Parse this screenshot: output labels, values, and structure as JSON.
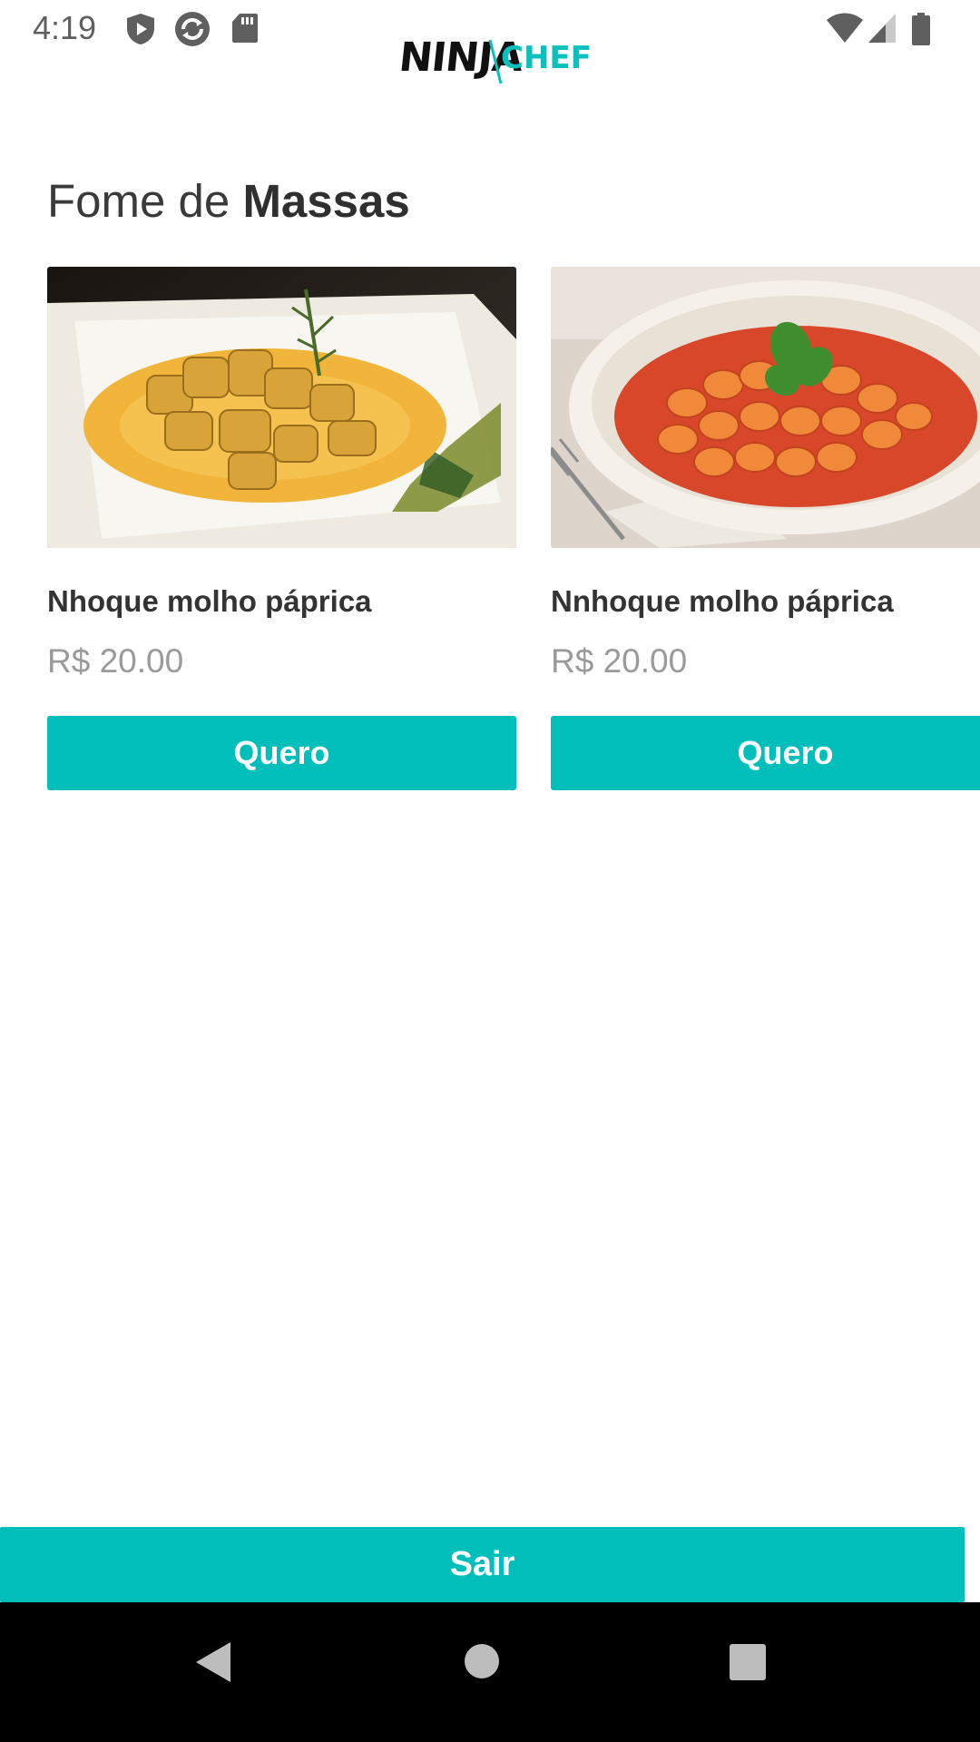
{
  "status_bar": {
    "time": "4:19",
    "icons": [
      "shield-icon",
      "sync-icon",
      "sd-card-icon",
      "wifi-icon",
      "signal-icon",
      "battery-icon"
    ]
  },
  "app": {
    "logo_ninja": "NINJA",
    "logo_chef": "CHEF",
    "accent_color": "#00bfbb"
  },
  "section": {
    "title_prefix": "Fome de ",
    "title_bold": "Massas"
  },
  "products": [
    {
      "name": "Nhoque molho páprica",
      "price": "R$ 20.00",
      "button_label": "Quero"
    },
    {
      "name": "Nnhoque molho páprica",
      "price": "R$ 20.00",
      "button_label": "Quero"
    }
  ],
  "footer": {
    "exit_label": "Sair"
  },
  "nav_bar": {
    "icons": [
      "back-icon",
      "home-icon",
      "recents-icon"
    ]
  }
}
